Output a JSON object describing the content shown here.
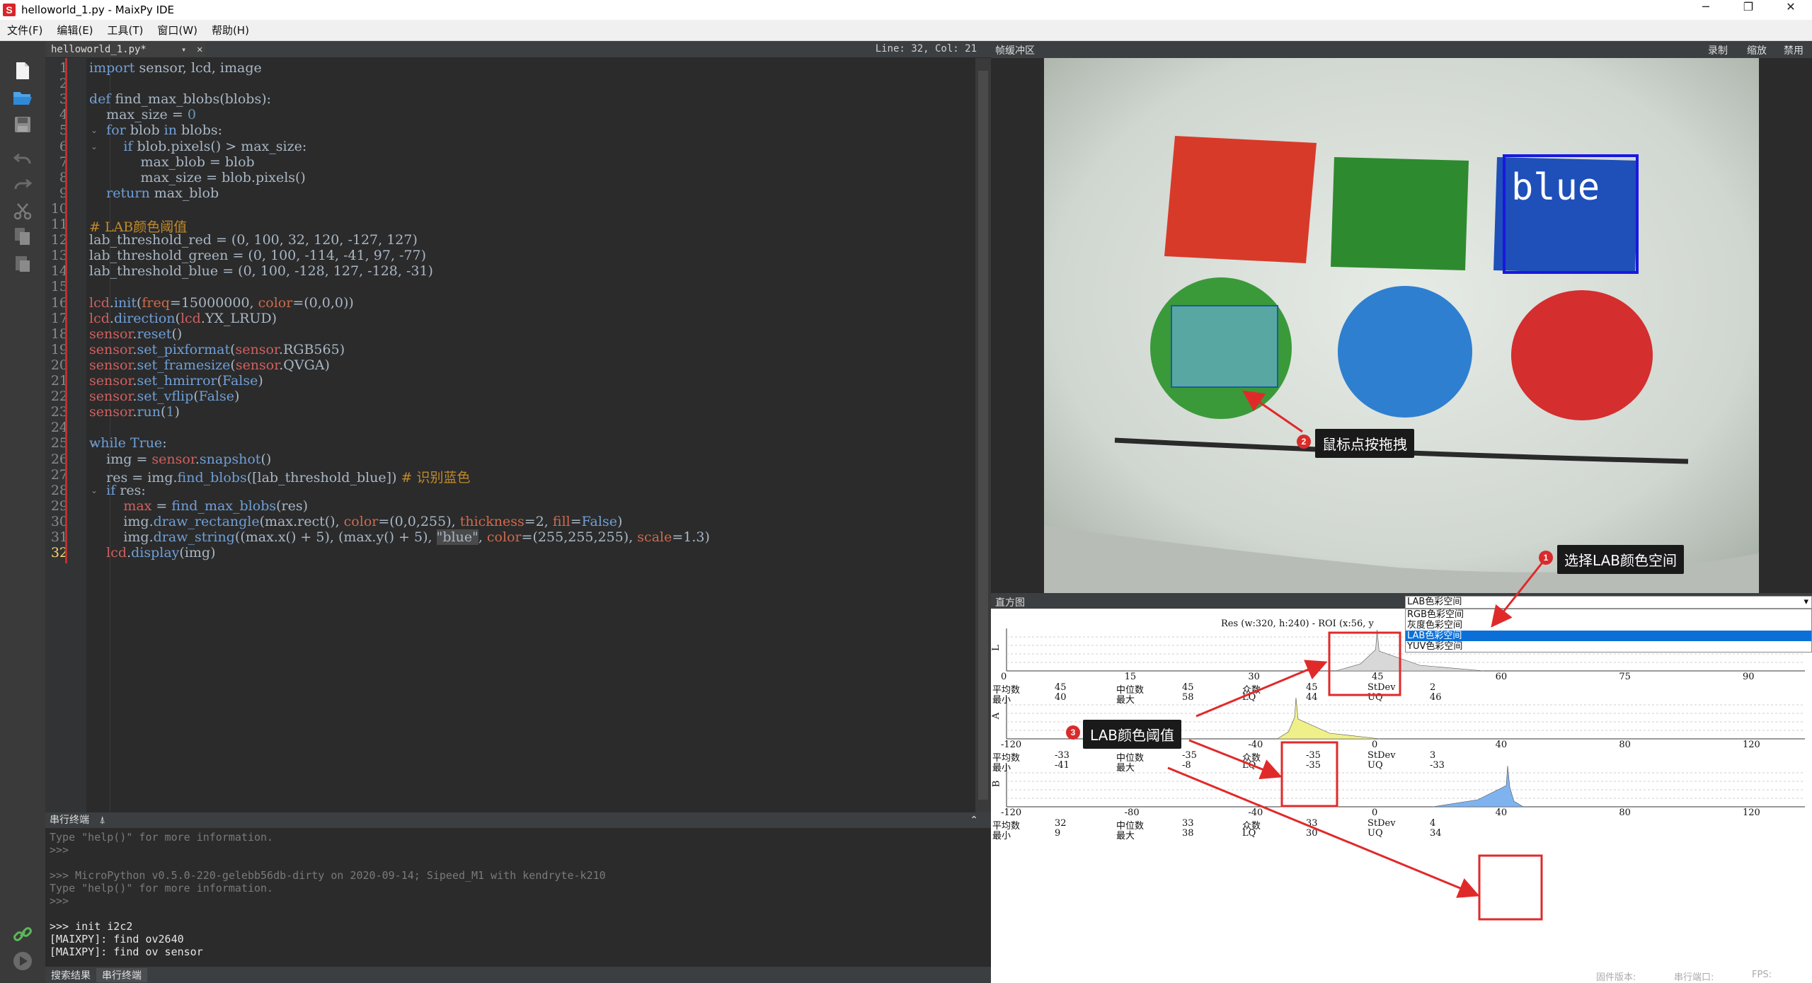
{
  "window": {
    "title": "helloworld_1.py - MaixPy IDE",
    "app_icon_letter": "S",
    "min": "─",
    "max": "❐",
    "close": "✕"
  },
  "menu": [
    "文件(F)",
    "编辑(E)",
    "工具(T)",
    "窗口(W)",
    "帮助(H)"
  ],
  "editor": {
    "tab_label": "helloworld_1.py*",
    "tab_dropdown": "▾",
    "tab_close": "✕",
    "cursor_pos": "Line: 32, Col: 21",
    "current_line": 32,
    "lines": [
      [
        [
          "kw",
          "import "
        ],
        [
          "plain",
          "sensor, lcd, image"
        ]
      ],
      [],
      [
        [
          "kw",
          "def "
        ],
        [
          "plain",
          "find_max_blobs(blobs):"
        ]
      ],
      [
        [
          "plain",
          "    max_size = "
        ],
        [
          "num",
          "0"
        ]
      ],
      [
        [
          "kw",
          "    for "
        ],
        [
          "plain",
          "blob "
        ],
        [
          "kw",
          "in "
        ],
        [
          "plain",
          "blobs:"
        ]
      ],
      [
        [
          "kw",
          "        if "
        ],
        [
          "plain",
          "blob.pixels() > max_size:"
        ]
      ],
      [
        [
          "plain",
          "            max_blob = blob"
        ]
      ],
      [
        [
          "plain",
          "            max_size = blob.pixels()"
        ]
      ],
      [
        [
          "kw",
          "    return "
        ],
        [
          "plain",
          "max_blob"
        ]
      ],
      [],
      [
        [
          "cm",
          "# LAB颜色阈值"
        ]
      ],
      [
        [
          "plain",
          "lab_threshold_red = (0, 100, 32, 120, -127, 127)"
        ]
      ],
      [
        [
          "plain",
          "lab_threshold_green = (0, 100, -114, -41, 97, -77)"
        ]
      ],
      [
        [
          "plain",
          "lab_threshold_blue = (0, 100, -128, 127, -128, -31)"
        ]
      ],
      [],
      [
        [
          "mod",
          "lcd"
        ],
        [
          "plain",
          "."
        ],
        [
          "kw",
          "init"
        ],
        [
          "plain",
          "("
        ],
        [
          "arg",
          "freq"
        ],
        [
          "plain",
          "=15000000, "
        ],
        [
          "arg",
          "color"
        ],
        [
          "plain",
          "=(0,0,0))"
        ]
      ],
      [
        [
          "mod",
          "lcd"
        ],
        [
          "plain",
          "."
        ],
        [
          "kw",
          "direction"
        ],
        [
          "plain",
          "("
        ],
        [
          "mod",
          "lcd"
        ],
        [
          "plain",
          ".YX_LRUD)"
        ]
      ],
      [
        [
          "mod",
          "sensor"
        ],
        [
          "plain",
          "."
        ],
        [
          "kw",
          "reset"
        ],
        [
          "plain",
          "()"
        ]
      ],
      [
        [
          "mod",
          "sensor"
        ],
        [
          "plain",
          "."
        ],
        [
          "kw",
          "set_pixformat"
        ],
        [
          "plain",
          "("
        ],
        [
          "mod",
          "sensor"
        ],
        [
          "plain",
          ".RGB565)"
        ]
      ],
      [
        [
          "mod",
          "sensor"
        ],
        [
          "plain",
          "."
        ],
        [
          "kw",
          "set_framesize"
        ],
        [
          "plain",
          "("
        ],
        [
          "mod",
          "sensor"
        ],
        [
          "plain",
          ".QVGA)"
        ]
      ],
      [
        [
          "mod",
          "sensor"
        ],
        [
          "plain",
          "."
        ],
        [
          "kw",
          "set_hmirror"
        ],
        [
          "plain",
          "("
        ],
        [
          "kw",
          "False"
        ],
        [
          "plain",
          ")"
        ]
      ],
      [
        [
          "mod",
          "sensor"
        ],
        [
          "plain",
          "."
        ],
        [
          "kw",
          "set_vflip"
        ],
        [
          "plain",
          "("
        ],
        [
          "kw",
          "False"
        ],
        [
          "plain",
          ")"
        ]
      ],
      [
        [
          "mod",
          "sensor"
        ],
        [
          "plain",
          "."
        ],
        [
          "kw",
          "run"
        ],
        [
          "plain",
          "("
        ],
        [
          "num",
          "1"
        ],
        [
          "plain",
          ")"
        ]
      ],
      [],
      [
        [
          "kw",
          "while "
        ],
        [
          "kw",
          "True"
        ],
        [
          "plain",
          ":"
        ]
      ],
      [
        [
          "plain",
          "    img = "
        ],
        [
          "mod",
          "sensor"
        ],
        [
          "plain",
          "."
        ],
        [
          "kw",
          "snapshot"
        ],
        [
          "plain",
          "()"
        ]
      ],
      [
        [
          "plain",
          "    res = img."
        ],
        [
          "kw",
          "find_blobs"
        ],
        [
          "plain",
          "([lab_threshold_blue]) "
        ],
        [
          "cm",
          "# 识别蓝色"
        ]
      ],
      [
        [
          "kw",
          "    if "
        ],
        [
          "plain",
          "res:"
        ]
      ],
      [
        [
          "mod",
          "        max"
        ],
        [
          "plain",
          " = "
        ],
        [
          "kw",
          "find_max_blobs"
        ],
        [
          "plain",
          "(res)"
        ]
      ],
      [
        [
          "plain",
          "        img."
        ],
        [
          "kw",
          "draw_rectangle"
        ],
        [
          "plain",
          "(max.rect(), "
        ],
        [
          "arg",
          "color"
        ],
        [
          "plain",
          "=(0,0,255), "
        ],
        [
          "arg",
          "thickness"
        ],
        [
          "plain",
          "=2, "
        ],
        [
          "arg",
          "fill"
        ],
        [
          "plain",
          "="
        ],
        [
          "kw",
          "False"
        ],
        [
          "plain",
          ")"
        ]
      ],
      [
        [
          "plain",
          "        img."
        ],
        [
          "kw",
          "draw_string"
        ],
        [
          "plain",
          "((max.x() + 5), (max.y() + 5), "
        ],
        [
          "str",
          "\"blue\""
        ],
        [
          "plain",
          ", "
        ],
        [
          "arg",
          "color"
        ],
        [
          "plain",
          "=(255,255,255), "
        ],
        [
          "arg",
          "scale"
        ],
        [
          "plain",
          "=1.3)"
        ]
      ],
      [
        [
          "plain",
          "    "
        ],
        [
          "mod",
          "lcd"
        ],
        [
          "plain",
          "."
        ],
        [
          "kw",
          "display"
        ],
        [
          "plain",
          "(img)"
        ]
      ]
    ],
    "fold_lines": [
      3,
      5,
      6,
      25,
      28
    ]
  },
  "serial": {
    "header_label": "串行终端",
    "header_icon": "⍋",
    "collapse": "⌃",
    "lines": [
      [
        "dim",
        "Type \"help()\" for more information."
      ],
      [
        "dim",
        ">>>"
      ],
      [
        "dim",
        ""
      ],
      [
        "dim",
        ">>> MicroPython v0.5.0-220-gelebb56db-dirty on 2020-09-14; Sipeed_M1 with kendryte-k210"
      ],
      [
        "dim",
        "Type \"help()\" for more information."
      ],
      [
        "dim",
        ">>>"
      ],
      [
        "dim",
        ""
      ],
      [
        "bright",
        ">>> init i2c2"
      ],
      [
        "bright",
        "[MAIXPY]: find ov2640"
      ],
      [
        "bright",
        "[MAIXPY]: find ov sensor"
      ]
    ]
  },
  "bottom_tabs": [
    "搜索结果",
    "串行终端"
  ],
  "right": {
    "framebuffer_label": "帧缓冲区",
    "fb_buttons": [
      "录制",
      "缩放",
      "禁用"
    ],
    "overlay_text": "blue",
    "hist_label": "直方图",
    "colorspace_selected": "LAB色彩空间",
    "colorspace_options": [
      "RGB色彩空间",
      "灰度色彩空间",
      "LAB色彩空间",
      "YUV色彩空间"
    ],
    "res_text": "Res (w:320, h:240) - ROI (x:56, y",
    "channels": [
      {
        "label": "L",
        "ticks": [
          "0",
          "15",
          "30",
          "45",
          "60",
          "75",
          "90"
        ],
        "stats": {
          "平均数": "45",
          "中位数": "45",
          "众数": "45",
          "StDev": "2",
          "最小": "40",
          "最大": "58",
          "LQ": "44",
          "UQ": "46"
        },
        "color": "#d8d8d8"
      },
      {
        "label": "A",
        "ticks": [
          "-120",
          "-80",
          "-40",
          "0",
          "40",
          "80",
          "120"
        ],
        "stats": {
          "平均数": "-33",
          "中位数": "-35",
          "众数": "-35",
          "StDev": "3",
          "最小": "-41",
          "最大": "-8",
          "LQ": "-35",
          "UQ": "-33"
        },
        "color": "#f0f08a"
      },
      {
        "label": "B",
        "ticks": [
          "-120",
          "-80",
          "-40",
          "0",
          "40",
          "80",
          "120"
        ],
        "stats": {
          "平均数": "32",
          "中位数": "33",
          "众数": "33",
          "StDev": "4",
          "最小": "9",
          "最大": "38",
          "LQ": "30",
          "UQ": "34"
        },
        "color": "#7fb3f0"
      }
    ],
    "status_labels": [
      "固件版本:",
      "串行端口:",
      "FPS:"
    ]
  },
  "annotations": [
    {
      "num": "1",
      "text": "选择LAB颜色空间"
    },
    {
      "num": "2",
      "text": "鼠标点按拖拽"
    },
    {
      "num": "3",
      "text": "LAB颜色阈值"
    }
  ],
  "colors": {
    "accent_red": "#e02a2a",
    "selection_blue": "#0a70d8"
  }
}
